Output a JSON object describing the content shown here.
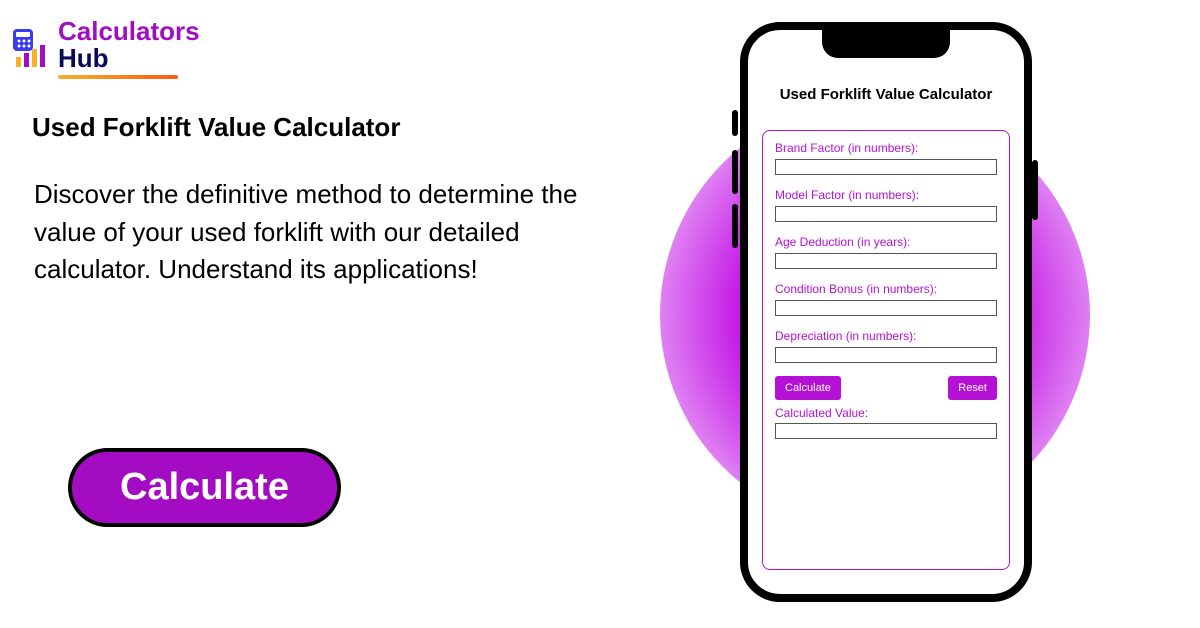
{
  "brand": {
    "name_part1": "Calculators",
    "name_part2": "Hub"
  },
  "hero": {
    "title": "Used Forklift Value Calculator",
    "description": "Discover the definitive method to determine the value of your used forklift with our detailed calculator. Understand its applications!",
    "cta_label": "Calculate"
  },
  "phone": {
    "title": "Used Forklift Value Calculator",
    "fields": [
      {
        "label": "Brand Factor (in numbers):",
        "value": ""
      },
      {
        "label": "Model Factor (in numbers):",
        "value": ""
      },
      {
        "label": "Age Deduction (in years):",
        "value": ""
      },
      {
        "label": "Condition Bonus (in numbers):",
        "value": ""
      },
      {
        "label": "Depreciation (in numbers):",
        "value": ""
      }
    ],
    "calc_btn": "Calculate",
    "reset_btn": "Reset",
    "output_label": "Calculated Value:",
    "output_value": ""
  },
  "colors": {
    "accent": "#a40cc4",
    "accent2": "#b511d6"
  }
}
